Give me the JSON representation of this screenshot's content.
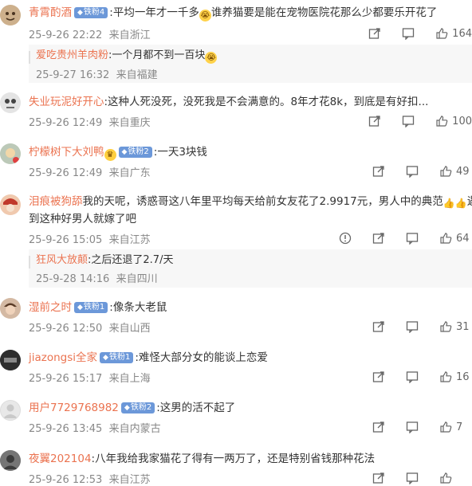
{
  "comments": [
    {
      "username": "青霄酌酒",
      "badge": "铁粉4",
      "text_before": ":平均一年才一千多",
      "text_after": "谁养猫要是能在宠物医院花那么少都要乐开花了",
      "date": "25-9-26 22:22",
      "location": "来自浙江",
      "likes": "164",
      "reply": {
        "username": "爱吃贵州羊肉粉",
        "text": ":一个月都不到一百块",
        "date": "25-9-27 16:32",
        "location": "来自福建"
      }
    },
    {
      "username": "失业玩泥好开心",
      "badge": "",
      "text": ":这种人死没死，没死我是不会满意的。8年才花8k，到底是有好扣...",
      "date": "25-9-26 12:49",
      "location": "来自重庆",
      "likes": "100"
    },
    {
      "username": "柠檬树下大刘鸭",
      "badge": "铁粉2",
      "text": ":一天3块钱",
      "date": "25-9-26 12:49",
      "location": "来自广东",
      "likes": "49"
    },
    {
      "username": "泪痕被狗舔",
      "badge": "",
      "text_line1": "我的天呢，诱惑哥这八年里平均每天给前女友花了2.9917元，男人中的典范",
      "text_line1_end": "遇",
      "text_line2": "到这种好男人就嫁了吧",
      "date": "25-9-26 15:05",
      "location": "来自江苏",
      "likes": "64",
      "reply": {
        "username": "狂风大放颠",
        "text": ":之后还退了2.7/天",
        "date": "25-9-28 14:16",
        "location": "来自四川"
      }
    },
    {
      "username": "湿前之时",
      "badge": "铁粉1",
      "text": ":像条大老鼠",
      "date": "25-9-26 12:50",
      "location": "来自山西",
      "likes": "31"
    },
    {
      "username": "jiazongsi全家",
      "badge": "铁粉1",
      "text": ":难怪大部分女的能谈上恋爱",
      "date": "25-9-26 15:17",
      "location": "来自上海",
      "likes": "16"
    },
    {
      "username": "用户7729768982",
      "badge": "铁粉2",
      "text": ":这男的活不起了",
      "date": "25-9-26 13:45",
      "location": "来自内蒙古",
      "likes": "7"
    },
    {
      "username": "夜翼202104",
      "badge": "",
      "text": ":八年我给我家猫花了得有一两万了，还是特别省钱那种花法",
      "date": "25-9-26 12:53",
      "location": "来自江苏",
      "likes": ""
    }
  ]
}
